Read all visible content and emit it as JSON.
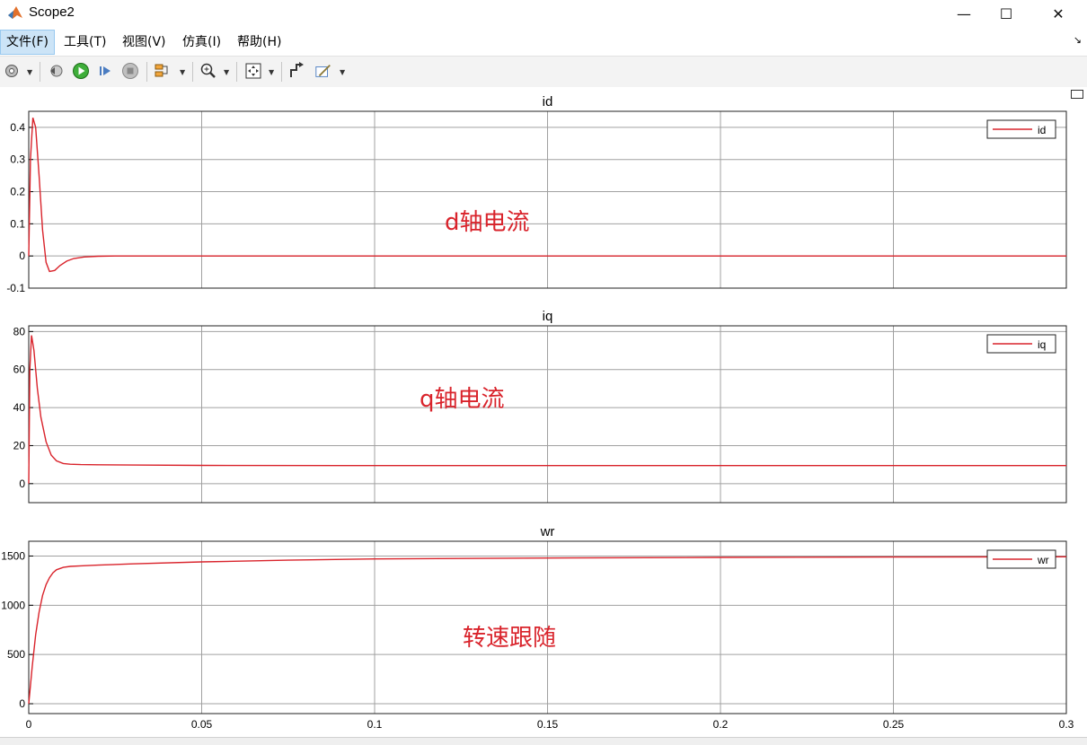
{
  "window": {
    "title": "Scope2",
    "minimize": "—",
    "maximize": "☐",
    "close": "✕"
  },
  "menu": {
    "items": [
      {
        "label": "文件(F)"
      },
      {
        "label": "工具(T)"
      },
      {
        "label": "视图(V)"
      },
      {
        "label": "仿真(I)"
      },
      {
        "label": "帮助(H)"
      }
    ]
  },
  "toolbar": {
    "icons": [
      "gear-icon",
      "step-back-icon",
      "run-icon",
      "step-forward-icon",
      "stop-icon",
      "signal-select-icon",
      "zoom-icon",
      "fit-view-icon",
      "cursor-measure-icon",
      "style-icon"
    ]
  },
  "colors": {
    "trace": "#d9232b",
    "grid": "#a0a0a0",
    "annotation": "#d9232b",
    "menu_active": "#cce4f7"
  },
  "chart_data": [
    {
      "type": "line",
      "title": "id",
      "legend": "id",
      "legend_position": "top-right",
      "xlim": [
        0,
        0.3
      ],
      "ylim": [
        -0.1,
        0.45
      ],
      "yticks": [
        "-0.1",
        "0",
        "0.1",
        "0.2",
        "0.3",
        "0.4"
      ],
      "xticks": [],
      "grid": true,
      "annotation": "d轴电流",
      "series": [
        {
          "name": "id",
          "x": [
            0,
            0.0005,
            0.0012,
            0.002,
            0.003,
            0.004,
            0.005,
            0.006,
            0.0075,
            0.009,
            0.011,
            0.013,
            0.016,
            0.02,
            0.025,
            0.03,
            0.05,
            0.1,
            0.15,
            0.2,
            0.25,
            0.3
          ],
          "y": [
            0,
            0.3,
            0.43,
            0.4,
            0.25,
            0.08,
            -0.02,
            -0.048,
            -0.045,
            -0.03,
            -0.016,
            -0.008,
            -0.003,
            -0.001,
            0,
            0,
            0,
            0,
            0,
            0,
            0,
            0
          ]
        }
      ]
    },
    {
      "type": "line",
      "title": "iq",
      "legend": "iq",
      "legend_position": "top-right",
      "xlim": [
        0,
        0.3
      ],
      "ylim": [
        -10,
        83
      ],
      "yticks": [
        "0",
        "20",
        "40",
        "60",
        "80"
      ],
      "xticks": [],
      "grid": true,
      "annotation": "q轴电流",
      "series": [
        {
          "name": "iq",
          "x": [
            0,
            0.0003,
            0.0008,
            0.0015,
            0.0025,
            0.0035,
            0.005,
            0.0065,
            0.008,
            0.01,
            0.012,
            0.015,
            0.02,
            0.03,
            0.05,
            0.1,
            0.15,
            0.2,
            0.25,
            0.3
          ],
          "y": [
            0,
            60,
            78,
            70,
            50,
            35,
            22,
            15,
            12,
            10.6,
            10.2,
            10,
            9.9,
            9.8,
            9.6,
            9.5,
            9.5,
            9.5,
            9.5,
            9.5
          ]
        }
      ]
    },
    {
      "type": "line",
      "title": "wr",
      "legend": "wr",
      "legend_position": "top-right",
      "xlim": [
        0,
        0.3
      ],
      "ylim": [
        -100,
        1650
      ],
      "yticks": [
        "0",
        "500",
        "1000",
        "1500"
      ],
      "xticks": [
        "0",
        "0.05",
        "0.1",
        "0.15",
        "0.2",
        "0.25",
        "0.3"
      ],
      "grid": true,
      "annotation": "转速跟随",
      "series": [
        {
          "name": "wr",
          "x": [
            0,
            0.001,
            0.002,
            0.003,
            0.004,
            0.005,
            0.006,
            0.007,
            0.008,
            0.01,
            0.012,
            0.015,
            0.02,
            0.03,
            0.05,
            0.075,
            0.1,
            0.15,
            0.2,
            0.25,
            0.3
          ],
          "y": [
            0,
            380,
            700,
            930,
            1100,
            1210,
            1280,
            1330,
            1360,
            1385,
            1395,
            1400,
            1408,
            1420,
            1440,
            1458,
            1470,
            1480,
            1486,
            1490,
            1492
          ]
        }
      ]
    }
  ]
}
